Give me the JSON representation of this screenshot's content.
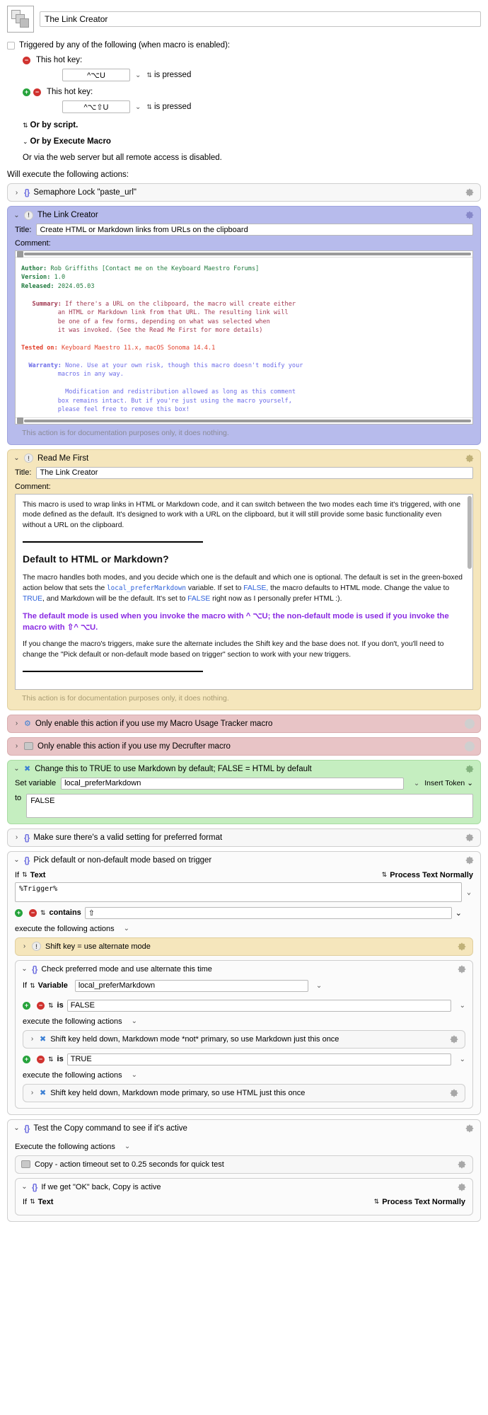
{
  "macro": {
    "name": "The Link Creator"
  },
  "trigger": {
    "checkbox_label": "Triggered by any of the following (when macro is enabled):",
    "hotkeys": [
      {
        "label": "This hot key:",
        "value": "^⌥U",
        "condition": "is pressed"
      },
      {
        "label": "This hot key:",
        "value": "^⌥⇧U",
        "condition": "is pressed"
      }
    ],
    "or_by_script": "Or by script.",
    "or_by_execute_macro": "Or by Execute Macro",
    "or_web_server": "Or via the web server but all remote access is disabled.",
    "will_execute": "Will execute the following actions:"
  },
  "actions": {
    "semaphore": {
      "title": "Semaphore Lock \"paste_url\""
    },
    "link_creator": {
      "header": "The Link Creator",
      "title_label": "Title:",
      "title_value": "Create HTML or Markdown links from URLs on the clipboard",
      "comment_label": "Comment:",
      "doc_note": "This action is for documentation purposes only, it does nothing.",
      "comment": {
        "author_key": "Author:",
        "author_val": "Rob Griffiths [Contact me on the Keyboard Maestro Forums]",
        "version_key": "Version:",
        "version_val": "1.0",
        "released_key": "Released:",
        "released_val": "2024.05.03",
        "summary_key": "Summary:",
        "summary_val": "If there's a URL on the clibpoard, the macro will create either\n          an HTML or Markdown link from that URL. The resulting link will\n          be one of a few forms, depending on what was selected when\n          it was invoked. (See the Read Me First for more details)",
        "tested_key": "Tested on:",
        "tested_val": "Keyboard Maestro 11.x, macOS Sonoma 14.4.1",
        "warranty_key": "Warranty:",
        "warranty_val": "None. Use at your own risk, though this macro doesn't modify your\n          macros in any way.",
        "license_val": "Modification and redistribution allowed as long as this comment\n          box remains intact. But if you're just using the macro yourself,\n          please feel free to remove this box!"
      }
    },
    "read_me_first": {
      "header": "Read Me First",
      "title_label": "Title:",
      "title_value": "The Link Creator",
      "comment_label": "Comment:",
      "doc_note": "This action is for documentation purposes only, it does nothing.",
      "p1": "This macro is used to wrap links in HTML or Markdown code, and it can switch between the two modes each time it's triggered, with one mode defined as the default. It's designed to work with a URL on the clipboard, but it will still provide some basic functionality even without a URL on the clipboard.",
      "heading": "Default to HTML or Markdown?",
      "p2_a": "The macro handles both modes, and you decide which one is the default and which one is optional. The default is set in the green-boxed action below that sets the ",
      "p2_code": "local_preferMarkdown",
      "p2_b": " variable. If set to ",
      "p2_false1": "FALSE,",
      "p2_c": " the macro defaults to HTML mode. Change the value to ",
      "p2_true": "TRUE",
      "p2_d": ", and Markdown will be the default. It's set to ",
      "p2_false2": "FALSE",
      "p2_e": " right now as I personally prefer HTML :).",
      "p3": "The default mode is used when you invoke the macro with ^ ⌥U; the non-default mode is used if you invoke the macro with ⇧^ ⌥U.",
      "p4": "If you change the macro's triggers, make sure the alternate includes the Shift key and the base does not. If you don't, you'll need to change the \"Pick default or non-default mode based on trigger\" section to work with your new triggers."
    },
    "disabled_rows": [
      {
        "title": "Only enable this action if you use my Macro Usage Tracker macro"
      },
      {
        "title": "Only enable this action if you use my Decrufter macro"
      }
    ],
    "set_markdown": {
      "header": "Change this to TRUE to use Markdown by default; FALSE = HTML by default",
      "set_variable_label": "Set variable",
      "variable_name": "local_preferMarkdown",
      "insert_token": "Insert Token",
      "to_label": "to",
      "to_value": "FALSE"
    },
    "valid_setting": {
      "title": "Make sure there's a valid setting for preferred format"
    },
    "pick_mode": {
      "header": "Pick default or non-default mode based on trigger",
      "if_label": "If",
      "if_type": "Text",
      "process_mode": "Process Text Normally",
      "text_value": "%Trigger%",
      "operator": "contains",
      "operand": "⇧",
      "execute_label": "execute the following actions",
      "shift_alt": {
        "title": "Shift key = use alternate mode"
      },
      "check_pref": {
        "header": "Check preferred mode and use alternate this time",
        "if_label": "If",
        "if_type": "Variable",
        "variable": "local_preferMarkdown",
        "op1": "is",
        "val1": "FALSE",
        "exec1": "execute the following actions",
        "child1": "Shift key held down, Markdown mode *not* primary, so use Markdown just this once",
        "op2": "is",
        "val2": "TRUE",
        "exec2": "execute the following actions",
        "child2": "Shift key held down, Markdown mode primary, so use HTML just this once"
      }
    },
    "test_copy": {
      "header": "Test the Copy command to see if it's active",
      "execute_label": "Execute the following actions",
      "timeout_row": "Copy - action timeout set to 0.25 seconds for quick test",
      "if_ok": {
        "header": "If we get \"OK\" back, Copy is active",
        "if_label": "If",
        "if_type": "Text",
        "process_mode": "Process Text Normally"
      }
    }
  },
  "colors": {
    "purple": "#b7bbec",
    "yellow": "#f5e6bc",
    "pink": "#e8c4c6",
    "green": "#c5eec0",
    "accent_blue": "#6d6ee0",
    "red_minus": "#d0322f",
    "green_plus": "#27a33c"
  }
}
